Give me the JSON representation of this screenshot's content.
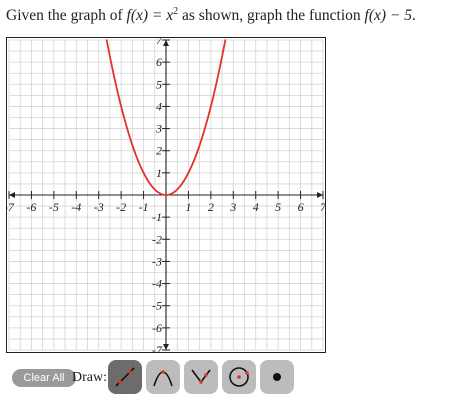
{
  "prompt": {
    "part1": "Given the graph of ",
    "math1": "f(x) = x",
    "exp": "2",
    "part2": " as shown, graph the function ",
    "math2": "f(x) − 5",
    "part3": "."
  },
  "chart_data": {
    "type": "line",
    "title": "",
    "xlabel": "",
    "ylabel": "",
    "xlim": [
      -7,
      7
    ],
    "ylim": [
      -7,
      7
    ],
    "grid": true,
    "x_ticks": [
      "-7",
      "-6",
      "-5",
      "-4",
      "-3",
      "-2",
      "-1",
      "1",
      "2",
      "3",
      "4",
      "5",
      "6",
      "7"
    ],
    "y_ticks": [
      "7",
      "6",
      "5",
      "4",
      "3",
      "2",
      "1",
      "-1",
      "-2",
      "-3",
      "-4",
      "-5",
      "-6",
      "-7"
    ],
    "series": [
      {
        "color": "#e0332c",
        "x": [
          -2.65,
          -2.5,
          -2,
          -1.5,
          -1,
          -0.5,
          0,
          0.5,
          1,
          1.5,
          2,
          2.5,
          2.65
        ],
        "y": [
          7,
          6.25,
          4,
          2.25,
          1,
          0.25,
          0,
          0.25,
          1,
          2.25,
          4,
          6.25,
          7
        ]
      }
    ]
  },
  "toolbar": {
    "clear_label": "Clear All",
    "draw_label": "Draw:",
    "tools": [
      {
        "icon": "line-tool-icon",
        "active": true
      },
      {
        "icon": "parabola-tool-icon",
        "active": false
      },
      {
        "icon": "absolute-value-tool-icon",
        "active": false
      },
      {
        "icon": "circle-tool-icon",
        "active": false
      },
      {
        "icon": "point-tool-icon",
        "active": false
      }
    ]
  },
  "colors": {
    "curve": "#e0332c",
    "tool_active": "#6c6c6c",
    "tool_inactive": "#bcbcbc",
    "clear_button": "#9a9a9a"
  }
}
